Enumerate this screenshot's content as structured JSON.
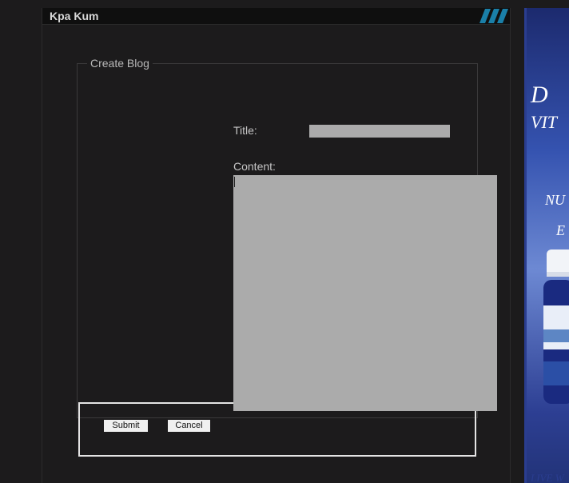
{
  "header": {
    "title": "Kpa Kum",
    "icon": "stripes-logo-icon"
  },
  "form": {
    "legend": "Create Blog",
    "title_label": "Title:",
    "title_value": "",
    "content_label": "Content:",
    "content_value": "",
    "submit_label": "Submit",
    "cancel_label": "Cancel"
  },
  "ad": {
    "line1": "D",
    "line2": "VIT",
    "line3": "NU",
    "line4": "E",
    "footer": "LIVE W"
  },
  "colors": {
    "accent": "#1a7fa8",
    "background": "#1c1b1c",
    "input_bg": "#ababab"
  }
}
